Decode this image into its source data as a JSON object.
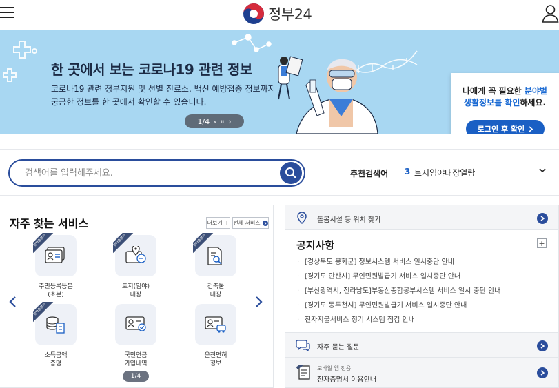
{
  "header": {
    "logo_text": "정부24",
    "menu_icon": "hamburger-icon",
    "user_icon": "user-icon"
  },
  "banner": {
    "title": "한 곳에서 보는 코로나19 관련 정보",
    "desc_line1": "코로나19 관련 정부지원 및 선별 진료소, 백신 예방접종 정보까지",
    "desc_line2": "궁금한 정보를 한 곳에서 확인할 수 있습니다.",
    "pager_text": "1/4",
    "prev": "‹",
    "pause": "ıı",
    "next": "›",
    "promo_line1": "나에게 꼭 필요한",
    "promo_hl1": "분야별",
    "promo_hl2": "생활정보를 확인",
    "promo_line2_suffix": "하세요.",
    "promo_button": "로그인 후 확인",
    "accent": "#1a5fc4",
    "bg": "#a8d7f2"
  },
  "search": {
    "placeholder": "검색어를 입력해주세요.",
    "rec_label": "추천검색어",
    "rec_num": "3",
    "rec_value": "토지임야대장열람"
  },
  "services": {
    "title": "자주 찾는 서비스",
    "more": "더보기",
    "all": "전체 서비스",
    "ribbon": "전자증명서",
    "items": [
      {
        "label": "주민등록등본\n(초본)",
        "icon": "resident-card-icon",
        "ribbon": true
      },
      {
        "label": "토지(임야)\n대장",
        "icon": "land-map-icon",
        "ribbon": true
      },
      {
        "label": "건축물\n대장",
        "icon": "building-document-icon",
        "ribbon": true
      },
      {
        "label": "소득금액\n증명",
        "icon": "income-coins-icon",
        "ribbon": true
      },
      {
        "label": "국민연금\n가입내역",
        "icon": "pension-check-icon",
        "ribbon": false
      },
      {
        "label": "운전면허\n정보",
        "icon": "driver-license-icon",
        "ribbon": false
      }
    ],
    "pager_text": "1/4"
  },
  "right": {
    "location_text": "돌봄시설 등 위치 찾기",
    "notice_title": "공지사항",
    "notices": [
      "[경상북도 봉화군] 정보시스템 서비스 일시중단 안내",
      "[경기도 안산시] 무인민원발급기 서비스 일시중단 안내",
      "[부산광역시, 전라남도]부동산종합공부시스템 서비스 일시 중단 안내",
      "[경기도 동두천시] 무인민원발급기 서비스 일시중단 안내",
      "전자지불서비스 정기 시스템 점검 안내"
    ],
    "faq_text": "자주 묻는 질문",
    "mobile_small": "모바일 앱 전용",
    "mobile_text": "전자증명서 이용안내"
  }
}
